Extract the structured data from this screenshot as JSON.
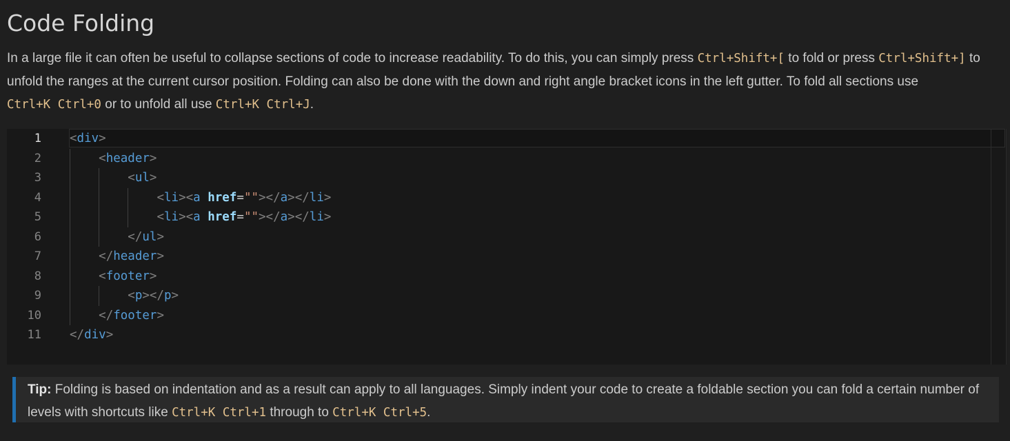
{
  "doc": {
    "title": "Code Folding",
    "intro": {
      "p1": "In a large file it can often be useful to collapse sections of code to increase readability. To do this, you can simply press ",
      "k1": "Ctrl+Shift+[",
      "p2": " to fold or press ",
      "k2": "Ctrl+Shift+]",
      "p3": " to unfold the ranges at the current cursor position. Folding can also be done with the down and right angle bracket icons in the left gutter. To fold all sections use ",
      "k3": "Ctrl+K Ctrl+0",
      "p4": " or to unfold all use ",
      "k4": "Ctrl+K Ctrl+J",
      "p5": "."
    }
  },
  "editor": {
    "line_numbers": [
      "1",
      "2",
      "3",
      "4",
      "5",
      "6",
      "7",
      "8",
      "9",
      "10",
      "11"
    ],
    "active_line": "1",
    "lines": [
      {
        "indent": "",
        "tokens": [
          [
            "bracket",
            "<"
          ],
          [
            "tag",
            "div"
          ],
          [
            "bracket",
            ">"
          ]
        ]
      },
      {
        "indent": "    ",
        "tokens": [
          [
            "bracket",
            "<"
          ],
          [
            "tag",
            "header"
          ],
          [
            "bracket",
            ">"
          ]
        ]
      },
      {
        "indent": "        ",
        "tokens": [
          [
            "bracket",
            "<"
          ],
          [
            "tag",
            "ul"
          ],
          [
            "bracket",
            ">"
          ]
        ]
      },
      {
        "indent": "            ",
        "tokens": [
          [
            "bracket",
            "<"
          ],
          [
            "tag",
            "li"
          ],
          [
            "bracket",
            "><"
          ],
          [
            "tag",
            "a"
          ],
          [
            "plain",
            " "
          ],
          [
            "attr",
            "href"
          ],
          [
            "plain",
            "="
          ],
          [
            "str",
            "\"\""
          ],
          [
            "bracket",
            "></"
          ],
          [
            "tag",
            "a"
          ],
          [
            "bracket",
            "></"
          ],
          [
            "tag",
            "li"
          ],
          [
            "bracket",
            ">"
          ]
        ]
      },
      {
        "indent": "            ",
        "tokens": [
          [
            "bracket",
            "<"
          ],
          [
            "tag",
            "li"
          ],
          [
            "bracket",
            "><"
          ],
          [
            "tag",
            "a"
          ],
          [
            "plain",
            " "
          ],
          [
            "attr",
            "href"
          ],
          [
            "plain",
            "="
          ],
          [
            "str",
            "\"\""
          ],
          [
            "bracket",
            "></"
          ],
          [
            "tag",
            "a"
          ],
          [
            "bracket",
            "></"
          ],
          [
            "tag",
            "li"
          ],
          [
            "bracket",
            ">"
          ]
        ]
      },
      {
        "indent": "        ",
        "tokens": [
          [
            "bracket",
            "</"
          ],
          [
            "tag",
            "ul"
          ],
          [
            "bracket",
            ">"
          ]
        ]
      },
      {
        "indent": "    ",
        "tokens": [
          [
            "bracket",
            "</"
          ],
          [
            "tag",
            "header"
          ],
          [
            "bracket",
            ">"
          ]
        ]
      },
      {
        "indent": "    ",
        "tokens": [
          [
            "bracket",
            "<"
          ],
          [
            "tag",
            "footer"
          ],
          [
            "bracket",
            ">"
          ]
        ]
      },
      {
        "indent": "        ",
        "tokens": [
          [
            "bracket",
            "<"
          ],
          [
            "tag",
            "p"
          ],
          [
            "bracket",
            "></"
          ],
          [
            "tag",
            "p"
          ],
          [
            "bracket",
            ">"
          ]
        ]
      },
      {
        "indent": "    ",
        "tokens": [
          [
            "bracket",
            "</"
          ],
          [
            "tag",
            "footer"
          ],
          [
            "bracket",
            ">"
          ]
        ]
      },
      {
        "indent": "",
        "tokens": [
          [
            "bracket",
            "</"
          ],
          [
            "tag",
            "div"
          ],
          [
            "bracket",
            ">"
          ]
        ]
      }
    ]
  },
  "tip": {
    "label": "Tip:",
    "t1": " Folding is based on indentation and as a result can apply to all languages. Simply indent your code to create a foldable section you can fold a certain number of levels with shortcuts like ",
    "k1": "Ctrl+K Ctrl+1",
    "t2": " through to ",
    "k2": "Ctrl+K Ctrl+5",
    "t3": "."
  },
  "colors": {
    "background": "#1f1f1f",
    "editor_background": "#181818",
    "shortcut": "#e2c08d",
    "tag": "#569cd6",
    "attribute": "#9cdcfe",
    "string": "#ce9178",
    "tip_accent": "#1f6fb0"
  }
}
